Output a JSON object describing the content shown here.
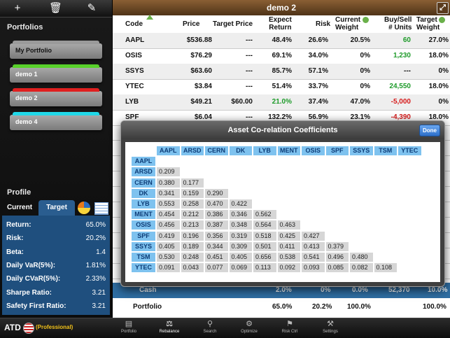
{
  "toolbar": {
    "add_icon": "+",
    "trash_icon": "🗑",
    "edit_icon": "✎"
  },
  "portfolios": {
    "title": "Portfolios",
    "items": [
      {
        "label": "My Portfolio",
        "color": "#9a9a9a"
      },
      {
        "label": "demo 1",
        "color": "#58d02a"
      },
      {
        "label": "demo 2",
        "color": "#e02020"
      },
      {
        "label": "demo 4",
        "color": "#20d8e8"
      }
    ]
  },
  "profile": {
    "title": "Profile",
    "tab_current": "Current",
    "tab_target": "Target",
    "metrics": [
      {
        "label": "Return:",
        "value": "65.0%"
      },
      {
        "label": "Risk:",
        "value": "20.2%"
      },
      {
        "label": "Beta:",
        "value": "1.4"
      },
      {
        "label": "Daily VaR(5%):",
        "value": "1.81%"
      },
      {
        "label": "Daily CVaR(5%):",
        "value": "2.33%"
      },
      {
        "label": "Sharpe Ratio:",
        "value": "3.21"
      },
      {
        "label": "Safety First Ratio:",
        "value": "3.21"
      }
    ]
  },
  "main": {
    "title": "demo 2",
    "expand_icon": "⤢",
    "columns": {
      "code": "Code",
      "price": "Price",
      "target_price": "Target Price",
      "expect_return": [
        "Expect",
        "Return"
      ],
      "risk": "Risk",
      "current_weight": [
        "Current",
        "Weight"
      ],
      "buysell": [
        "Buy/Sell",
        "# Units"
      ],
      "target_weight": [
        "Target",
        "Weight"
      ]
    },
    "rows": [
      {
        "code": "AAPL",
        "price": "$536.88",
        "target_price": "---",
        "expect_return": "48.4%",
        "risk": "26.6%",
        "current_weight": "20.5%",
        "buysell": "60",
        "target_weight": "27.0%",
        "ret_color": "",
        "bs_color": "green"
      },
      {
        "code": "OSIS",
        "price": "$76.29",
        "target_price": "---",
        "expect_return": "69.1%",
        "risk": "34.0%",
        "current_weight": "0%",
        "buysell": "1,230",
        "target_weight": "18.0%",
        "ret_color": "",
        "bs_color": "green"
      },
      {
        "code": "SSYS",
        "price": "$63.60",
        "target_price": "---",
        "expect_return": "85.7%",
        "risk": "57.1%",
        "current_weight": "0%",
        "buysell": "---",
        "target_weight": "0%",
        "ret_color": "",
        "bs_color": ""
      },
      {
        "code": "YTEC",
        "price": "$3.84",
        "target_price": "---",
        "expect_return": "51.4%",
        "risk": "33.7%",
        "current_weight": "0%",
        "buysell": "24,550",
        "target_weight": "18.0%",
        "ret_color": "",
        "bs_color": "green"
      },
      {
        "code": "LYB",
        "price": "$49.21",
        "target_price": "$60.00",
        "expect_return": "21.0%",
        "risk": "37.4%",
        "current_weight": "47.0%",
        "buysell": "-5,000",
        "target_weight": "0%",
        "ret_color": "green",
        "bs_color": "red"
      },
      {
        "code": "SPF",
        "price": "$6.04",
        "target_price": "---",
        "expect_return": "132.2%",
        "risk": "56.9%",
        "current_weight": "23.1%",
        "buysell": "-4,390",
        "target_weight": "18.0%",
        "ret_color": "",
        "bs_color": "red"
      }
    ],
    "cash": {
      "label": "Cash",
      "expect_return": "2.0%",
      "risk": "0%",
      "current_weight": "0.0%",
      "buysell": "52,370",
      "target_weight": "10.0%"
    },
    "portfolio": {
      "label": "Portfolio",
      "expect_return": "65.0%",
      "risk": "20.2%",
      "current_weight": "100.0%",
      "target_weight": "100.0%"
    }
  },
  "popup": {
    "title": "Asset Co-relation Coefficients",
    "done_label": "Done",
    "assets": [
      "AAPL",
      "ARSD",
      "CERN",
      "DK",
      "LYB",
      "MENT",
      "OSIS",
      "SPF",
      "SSYS",
      "TSM",
      "YTEC"
    ],
    "matrix": [
      [],
      [
        "0.209"
      ],
      [
        "0.380",
        "0.177"
      ],
      [
        "0.341",
        "0.159",
        "0.290"
      ],
      [
        "0.553",
        "0.258",
        "0.470",
        "0.422"
      ],
      [
        "0.454",
        "0.212",
        "0.386",
        "0.346",
        "0.562"
      ],
      [
        "0.456",
        "0.213",
        "0.387",
        "0.348",
        "0.564",
        "0.463"
      ],
      [
        "0.419",
        "0.196",
        "0.356",
        "0.319",
        "0.518",
        "0.425",
        "0.427"
      ],
      [
        "0.405",
        "0.189",
        "0.344",
        "0.309",
        "0.501",
        "0.411",
        "0.413",
        "0.379"
      ],
      [
        "0.530",
        "0.248",
        "0.451",
        "0.405",
        "0.656",
        "0.538",
        "0.541",
        "0.496",
        "0.480"
      ],
      [
        "0.091",
        "0.043",
        "0.077",
        "0.069",
        "0.113",
        "0.092",
        "0.093",
        "0.085",
        "0.082",
        "0.108"
      ]
    ]
  },
  "bottombar": {
    "brand": "ATD",
    "edition": "(Professional)",
    "nav": [
      {
        "label": "Portfolio",
        "icon": "▤",
        "name": "portfolio"
      },
      {
        "label": "Rebalance",
        "icon": "⚖",
        "name": "rebalance"
      },
      {
        "label": "Search",
        "icon": "⚲",
        "name": "search"
      },
      {
        "label": "Optimize",
        "icon": "⚙",
        "name": "optimize"
      },
      {
        "label": "Risk Ctrl",
        "icon": "⚑",
        "name": "risk-ctrl"
      },
      {
        "label": "Settings",
        "icon": "⚒",
        "name": "settings"
      }
    ],
    "active": "rebalance"
  }
}
